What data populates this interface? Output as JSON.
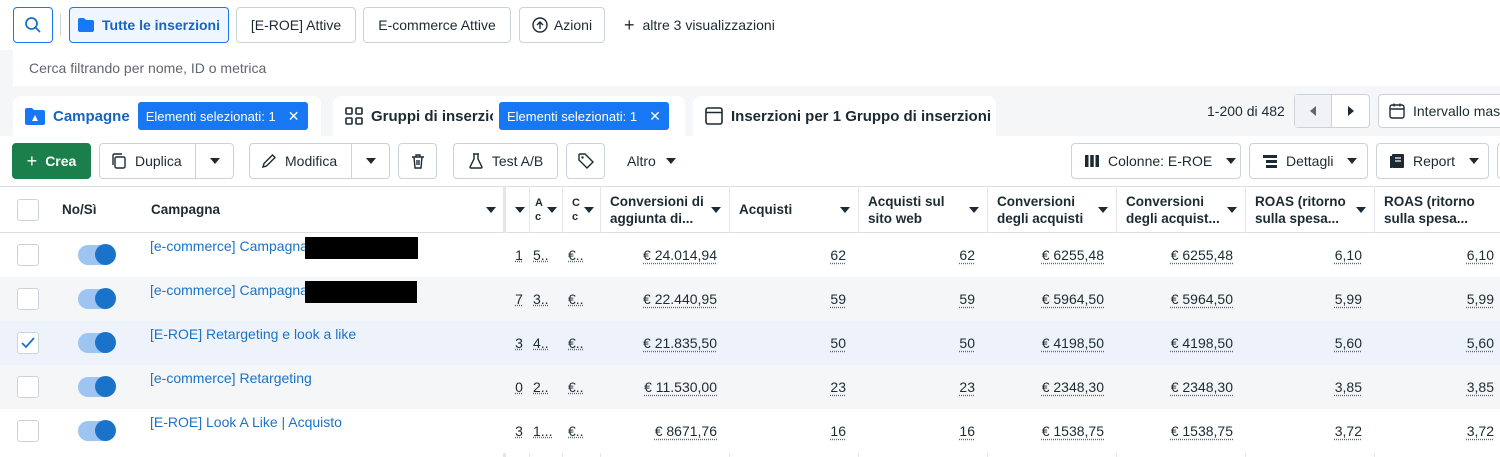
{
  "views": {
    "all_ads": "Tutte le inserzioni",
    "eroe_active": "[E-ROE] Attive",
    "ecommerce_active": "E-commerce Attive",
    "actions": "Azioni",
    "more_views": "altre 3 visualizzazioni"
  },
  "search": {
    "placeholder": "Cerca filtrando per nome, ID o metrica"
  },
  "tabs": {
    "campaigns": {
      "label": "Campagne",
      "badge": "Elementi selezionati: 1"
    },
    "adsets": {
      "label": "Gruppi di inserzioni",
      "badge": "Elementi selezionati: 1"
    },
    "ads": {
      "label": "Inserzioni per 1 Gruppo di inserzioni"
    }
  },
  "pagination": {
    "range": "1-200 di 482",
    "date_range_label": "Intervallo mas"
  },
  "toolbar": {
    "create": "Crea",
    "duplicate": "Duplica",
    "edit": "Modifica",
    "ab_test": "Test A/B",
    "more": "Altro",
    "columns": "Colonne: E-ROE",
    "details": "Dettagli",
    "report": "Report"
  },
  "columns": {
    "onoff": "No/Sì",
    "campaign": "Campagna",
    "c1": "A",
    "c1b": "c",
    "c2": "C",
    "c2b": "c",
    "add_conv_1": "Conversioni di",
    "add_conv_2": "aggiunta di...",
    "purchases": "Acquisti",
    "web_purchases_1": "Acquisti sul",
    "web_purchases_2": "sito web",
    "purchase_conv_1": "Conversioni",
    "purchase_conv_2": "degli acquisti",
    "purchase_conv2_1": "Conversioni",
    "purchase_conv2_2": "degli acquist...",
    "roas_1": "ROAS (ritorno",
    "roas_2": "sulla spesa...",
    "roas2_1": "ROAS (ritorno",
    "roas2_2": "sulla spesa..."
  },
  "rows": [
    {
      "name": "[e-commerce] Campagna",
      "checked": false,
      "t1": "1",
      "t2": "5..",
      "t3": "€..",
      "add_conv": "€ 24.014,94",
      "purchases": "62",
      "web_purchases": "62",
      "conv_value": "€ 6255,48",
      "conv_value2": "€ 6255,48",
      "roas": "6,10",
      "roas2": "6,10"
    },
    {
      "name": "[e-commerce] Campagna",
      "checked": false,
      "t1": "7",
      "t2": "3..",
      "t3": "€..",
      "add_conv": "€ 22.440,95",
      "purchases": "59",
      "web_purchases": "59",
      "conv_value": "€ 5964,50",
      "conv_value2": "€ 5964,50",
      "roas": "5,99",
      "roas2": "5,99"
    },
    {
      "name": "[E-ROE] Retargeting e look a like",
      "checked": true,
      "t1": "3",
      "t2": "4..",
      "t3": "€..",
      "add_conv": "€ 21.835,50",
      "purchases": "50",
      "web_purchases": "50",
      "conv_value": "€ 4198,50",
      "conv_value2": "€ 4198,50",
      "roas": "5,60",
      "roas2": "5,60"
    },
    {
      "name": "[e-commerce] Retargeting",
      "checked": false,
      "t1": "0",
      "t2": "2..",
      "t3": "€..",
      "add_conv": "€ 11.530,00",
      "purchases": "23",
      "web_purchases": "23",
      "conv_value": "€ 2348,30",
      "conv_value2": "€ 2348,30",
      "roas": "3,85",
      "roas2": "3,85"
    },
    {
      "name": "[E-ROE] Look A Like | Acquisto",
      "checked": false,
      "t1": "3",
      "t2": "1...",
      "t3": "€..",
      "add_conv": "€ 8671,76",
      "purchases": "16",
      "web_purchases": "16",
      "conv_value": "€ 1538,75",
      "conv_value2": "€ 1538,75",
      "roas": "3,72",
      "roas2": "3,72"
    }
  ]
}
